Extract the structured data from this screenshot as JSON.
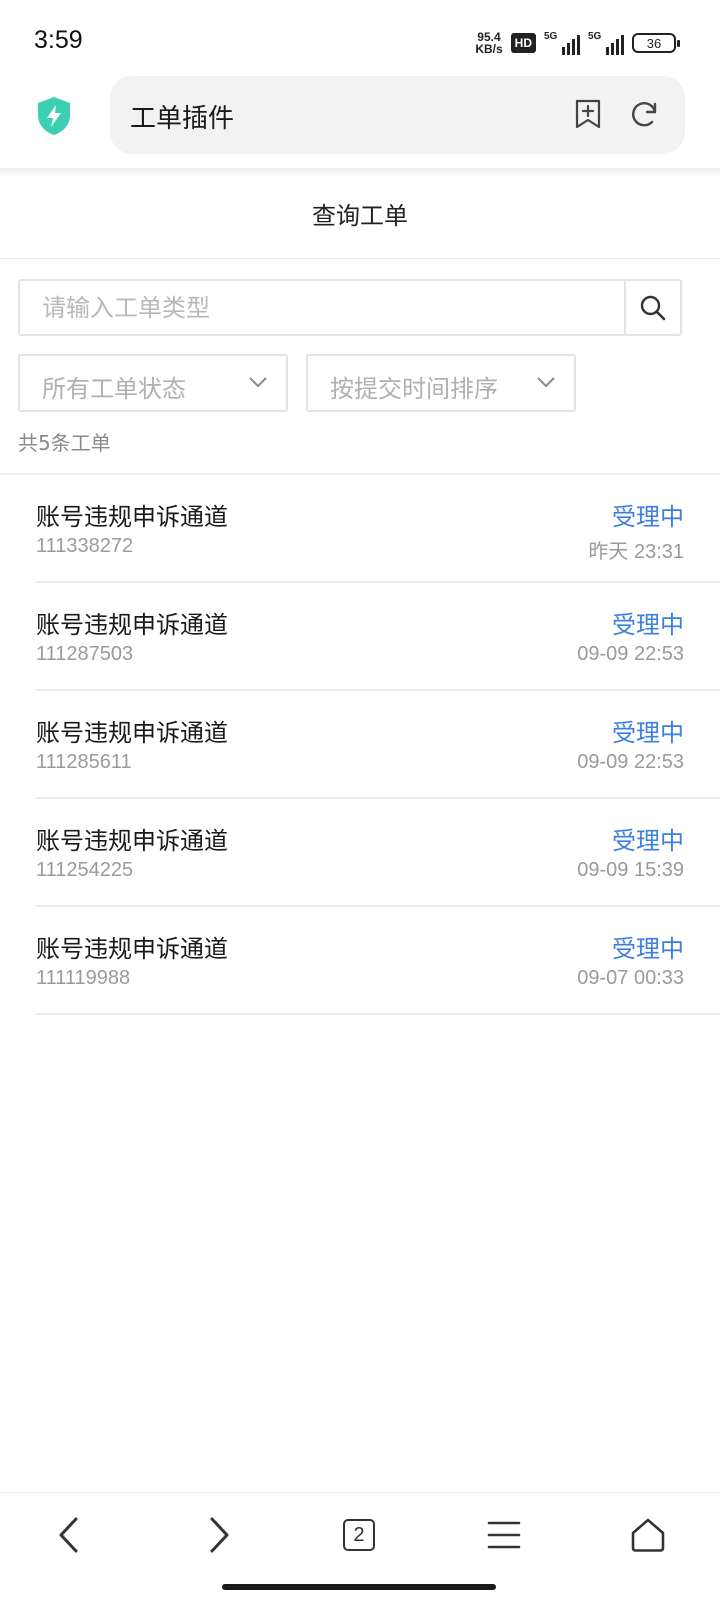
{
  "status_bar": {
    "time": "3:59",
    "net_speed_value": "95.4",
    "net_speed_unit": "KB/s",
    "hd_badge": "HD",
    "signal_1_label": "5G",
    "signal_2_label": "5G",
    "battery_level": "36"
  },
  "browser": {
    "url_title": "工单插件",
    "shield_color": "#3ccfb2",
    "tab_count": "2"
  },
  "page": {
    "title": "查询工单",
    "search_placeholder": "请输入工单类型",
    "filter_status": "所有工单状态",
    "filter_sort": "按提交时间排序",
    "count_text": "共5条工单"
  },
  "tickets": [
    {
      "title": "账号违规申诉通道",
      "id": "111338272",
      "status": "受理中",
      "time": "昨天 23:31"
    },
    {
      "title": "账号违规申诉通道",
      "id": "111287503",
      "status": "受理中",
      "time": "09-09 22:53"
    },
    {
      "title": "账号违规申诉通道",
      "id": "111285611",
      "status": "受理中",
      "time": "09-09 22:53"
    },
    {
      "title": "账号违规申诉通道",
      "id": "111254225",
      "status": "受理中",
      "time": "09-09 15:39"
    },
    {
      "title": "账号违规申诉通道",
      "id": "111119988",
      "status": "受理中",
      "time": "09-07 00:33"
    }
  ],
  "colors": {
    "status_accent": "#3d7ee0",
    "secondary_text": "#9a9a9a"
  },
  "icons": {
    "shield": "shield-bolt-icon",
    "bookmark": "bookmark-add-icon",
    "reload": "reload-icon",
    "search": "search-icon",
    "chevron": "chevron-down-icon",
    "back": "back-arrow-icon",
    "forward": "forward-arrow-icon",
    "tabs": "tabs-icon",
    "menu": "menu-icon",
    "home": "home-icon"
  }
}
